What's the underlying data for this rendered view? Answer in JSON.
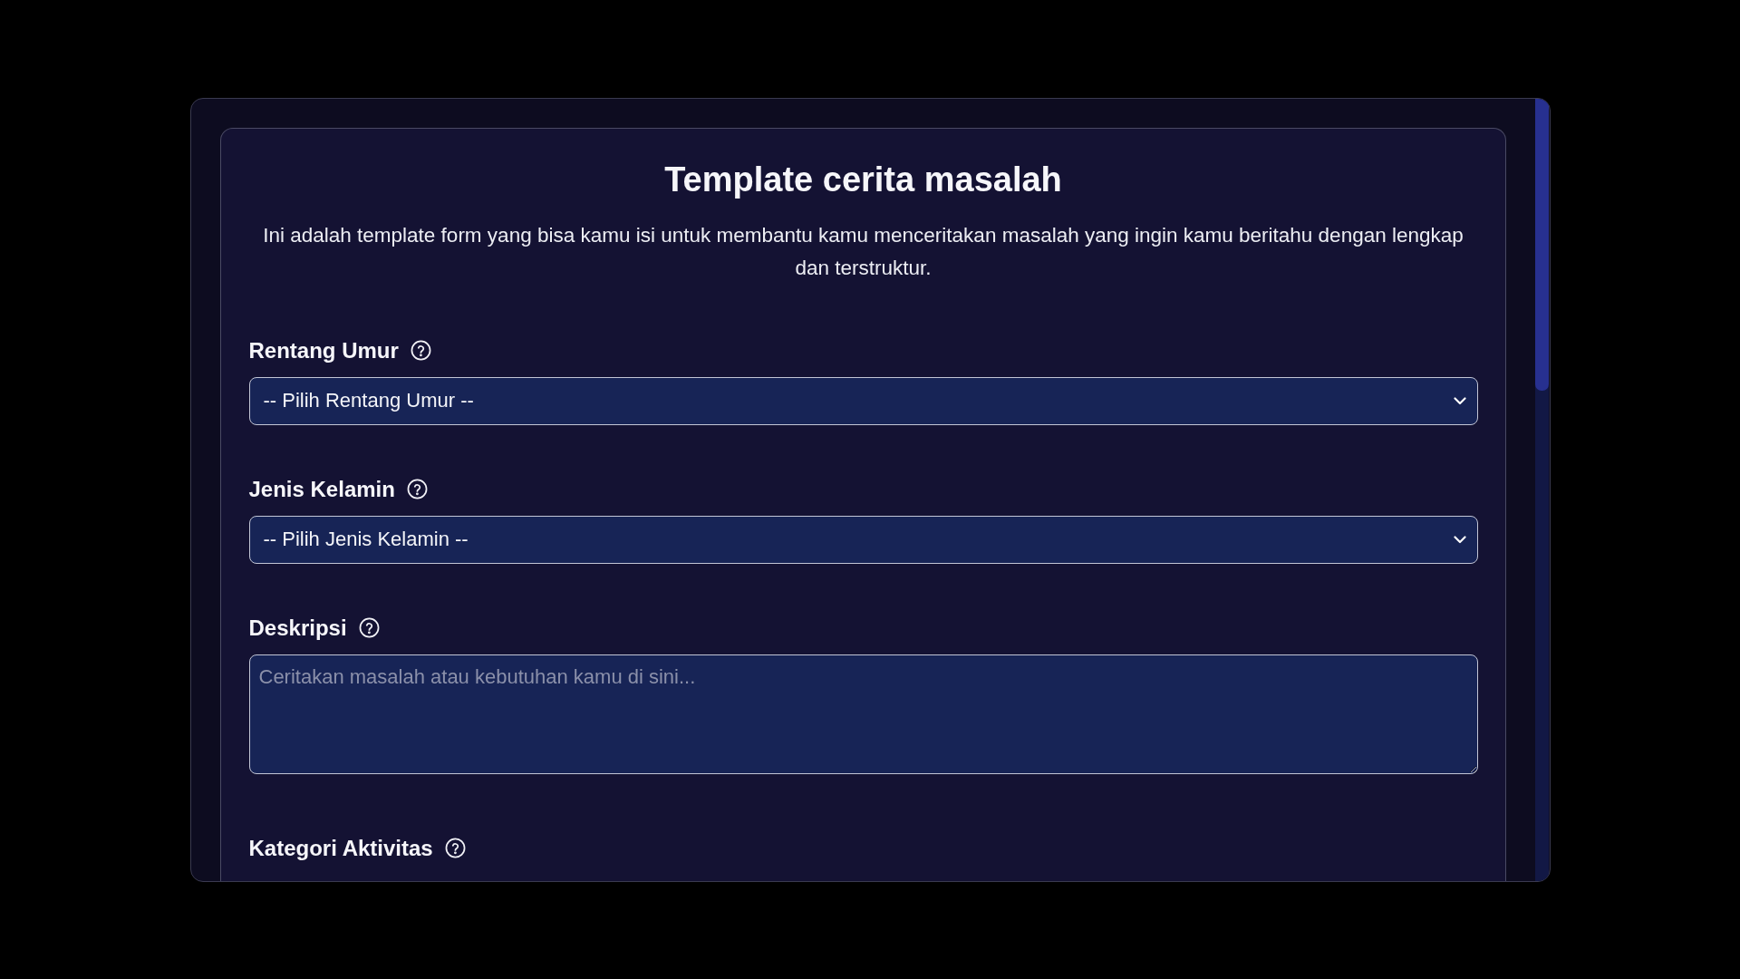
{
  "form": {
    "title": "Template cerita masalah",
    "description": "Ini adalah template form yang bisa kamu isi untuk membantu kamu menceritakan masalah yang ingin kamu beritahu dengan lengkap dan terstruktur.",
    "fields": [
      {
        "kind": "select",
        "label": "Rentang Umur",
        "value": "-- Pilih Rentang Umur --"
      },
      {
        "kind": "select",
        "label": "Jenis Kelamin",
        "value": "-- Pilih Jenis Kelamin --"
      },
      {
        "kind": "textarea",
        "label": "Deskripsi",
        "placeholder": "Ceritakan masalah atau kebutuhan kamu di sini..."
      },
      {
        "kind": "checklist",
        "label": "Kategori Aktivitas"
      }
    ]
  }
}
